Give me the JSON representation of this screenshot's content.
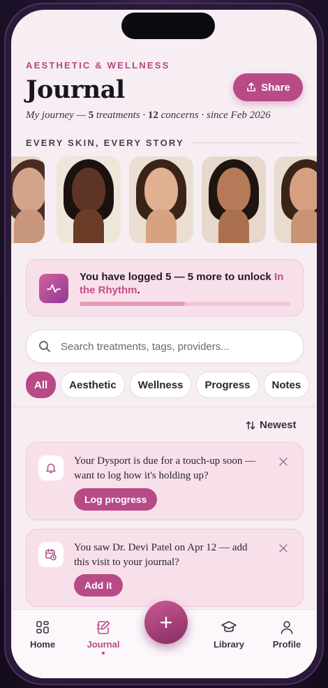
{
  "header": {
    "eyebrow": "AESTHETIC & WELLNESS",
    "title": "Journal",
    "share_label": "Share",
    "subtitle_prefix": "My journey — ",
    "treatments_count": "5",
    "treatments_label": " treatments · ",
    "concerns_count": "12",
    "concerns_label": " concerns · since Feb 2026"
  },
  "gallery": {
    "section_label": "EVERY SKIN, EVERY STORY"
  },
  "unlock": {
    "text": "You have logged 5 — 5 more to unlock ",
    "highlight": "In the Rhythm",
    "suffix": ".",
    "progress": 0.5
  },
  "search": {
    "placeholder": "Search treatments, tags, providers..."
  },
  "filters": [
    "All",
    "Aesthetic",
    "Wellness",
    "Progress",
    "Notes"
  ],
  "sort": {
    "label": "Newest"
  },
  "notifications": [
    {
      "text": "Your Dysport is due for a touch-up soon — want to log how it's holding up?",
      "button": "Log progress",
      "icon": "bell-icon"
    },
    {
      "text": "You saw Dr. Devi Patel on Apr 12 — add this visit to your journal?",
      "button": "Add it",
      "icon": "calendar-clock-icon"
    }
  ],
  "tabbar": {
    "home": "Home",
    "journal": "Journal",
    "add": "+",
    "library": "Library",
    "profile": "Profile"
  },
  "colors": {
    "accent": "#b84a86",
    "card": "#f8e0ea",
    "background": "#f6eef3"
  }
}
